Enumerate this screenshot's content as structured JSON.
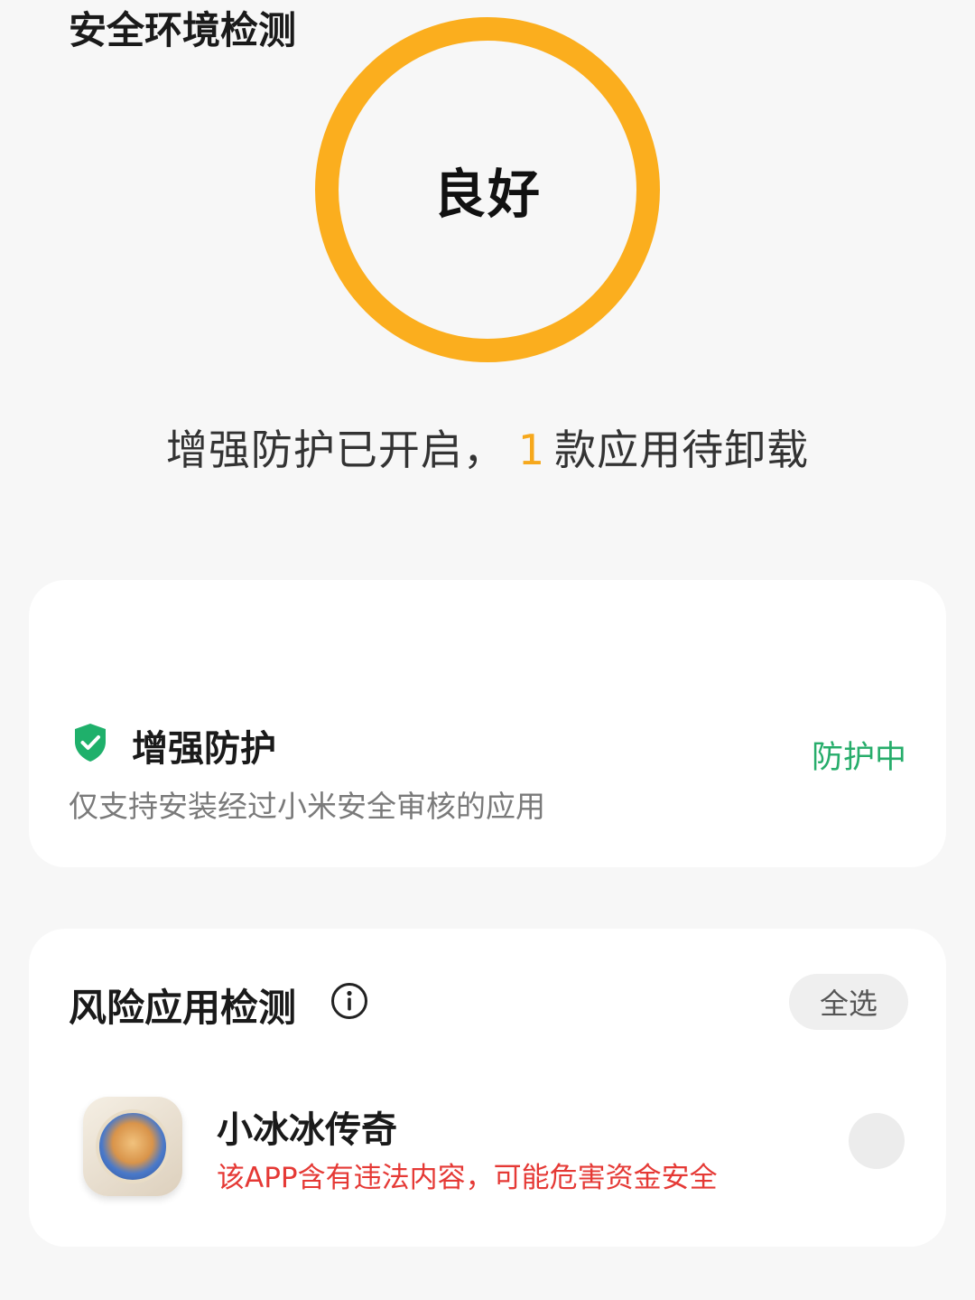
{
  "score": {
    "label": "良好",
    "ring_color": "#fbae1e"
  },
  "summary": {
    "prefix": "增强防护已开启，",
    "count": "1",
    "suffix": "款应用待卸载"
  },
  "env_card": {
    "title": "安全环境检测",
    "item": {
      "icon": "shield-check-icon",
      "title": "增强防护",
      "description": "仅支持安装经过小米安全审核的应用",
      "status": "防护中",
      "status_color": "#27ad6b"
    }
  },
  "risk_card": {
    "title": "风险应用检测",
    "info_icon": "info-icon",
    "select_all_label": "全选",
    "apps": [
      {
        "name": "小冰冰传奇",
        "warning": "该APP含有违法内容，可能危害资金安全",
        "warning_color": "#e53935",
        "selected": false
      }
    ]
  }
}
